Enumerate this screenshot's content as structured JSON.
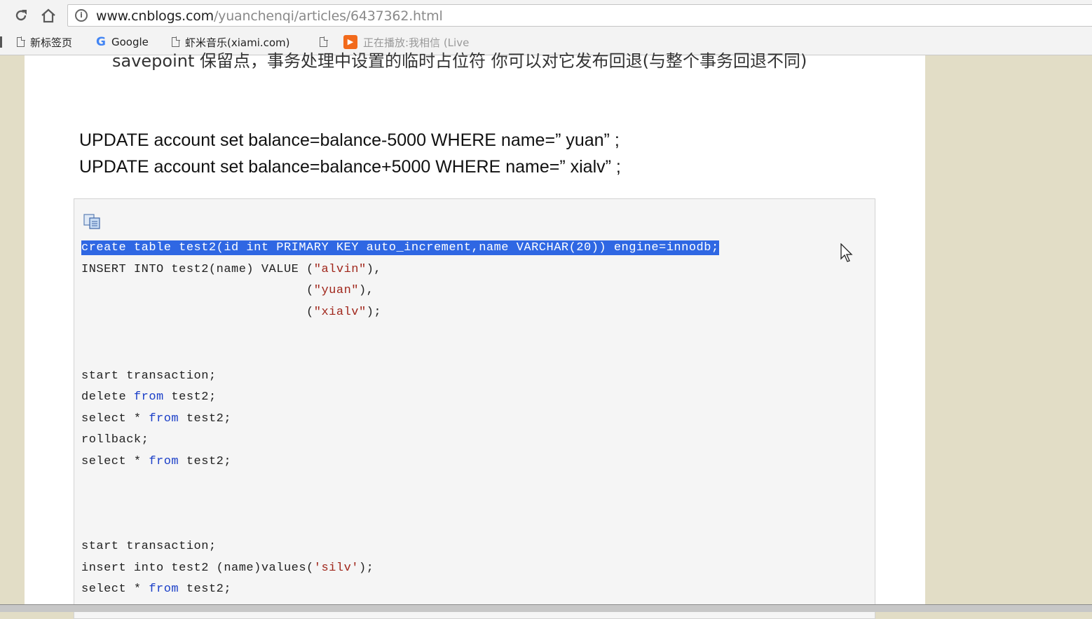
{
  "browser": {
    "url_host": "www.cnblogs.com",
    "url_path": "/yuanchenqi/articles/6437362.html",
    "bookmarks": [
      {
        "label": "新标签页",
        "icon": "page-icon"
      },
      {
        "label": "Google",
        "icon": "google-icon"
      },
      {
        "label": "虾米音乐(xiami.com)",
        "icon": "page-icon"
      },
      {
        "label": "",
        "icon": "page-icon"
      },
      {
        "label": "正在播放:我相信 (Live",
        "icon": "play-icon"
      }
    ]
  },
  "article": {
    "cut_text": "savepoint 保留点，事务处理中设置的临时占位符 你可以对它发布回退(与整个事务回退不同)",
    "sql_lines": [
      "UPDATE account set balance=balance-5000 WHERE name=” yuan” ;",
      "UPDATE account set balance=balance+5000 WHERE name=” xialv” ;"
    ],
    "code": {
      "l1": "create table test2(id int PRIMARY KEY auto_increment,name VARCHAR(20)) engine=innodb;",
      "l2_a": "INSERT INTO test2(name) VALUE (",
      "l2_s": "\"alvin\"",
      "l2_b": "),",
      "l3_a": "                              (",
      "l3_s": "\"yuan\"",
      "l3_b": "),",
      "l4_a": "                              (",
      "l4_s": "\"xialv\"",
      "l4_b": ");",
      "l5": "start transaction;",
      "l6_a": "delete ",
      "l6_k": "from",
      "l6_b": " test2;",
      "l7_a": "select * ",
      "l7_k": "from",
      "l7_b": " test2;",
      "l8": "rollback;",
      "l9_a": "select * ",
      "l9_k": "from",
      "l9_b": " test2;",
      "l10": "start transaction;",
      "l11_a": "insert into test2 (name)values(",
      "l11_s": "'silv'",
      "l11_b": ");",
      "l12_a": "select * ",
      "l12_k": "from",
      "l12_b": " test2;"
    }
  }
}
